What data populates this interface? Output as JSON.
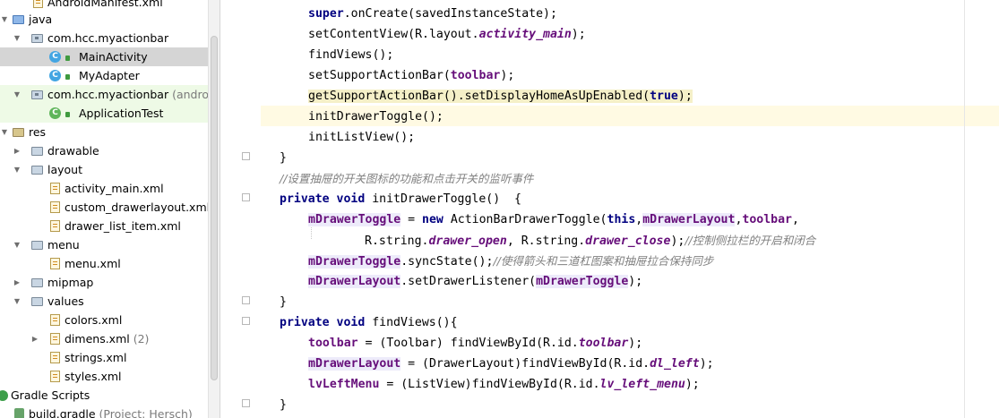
{
  "project_tree": {
    "items": [
      {
        "label": "AndroidManifest.xml",
        "suffix": "",
        "icon": "xml-file-icon"
      },
      {
        "label": "java",
        "suffix": "",
        "icon": "source-folder-icon"
      },
      {
        "label": "com.hcc.myactionbar",
        "suffix": "",
        "icon": "package-icon"
      },
      {
        "label": "MainActivity",
        "suffix": "",
        "icon": "class-icon"
      },
      {
        "label": "MyAdapter",
        "suffix": "",
        "icon": "class-icon"
      },
      {
        "label": "com.hcc.myactionbar",
        "suffix": " (androidTest)",
        "icon": "package-icon"
      },
      {
        "label": "ApplicationTest",
        "suffix": "",
        "icon": "test-class-icon"
      },
      {
        "label": "res",
        "suffix": "",
        "icon": "resource-folder-icon"
      },
      {
        "label": "drawable",
        "suffix": "",
        "icon": "folder-icon"
      },
      {
        "label": "layout",
        "suffix": "",
        "icon": "folder-icon"
      },
      {
        "label": "activity_main.xml",
        "suffix": "",
        "icon": "xml-file-icon"
      },
      {
        "label": "custom_drawerlayout.xml",
        "suffix": "",
        "icon": "xml-file-icon"
      },
      {
        "label": "drawer_list_item.xml",
        "suffix": "",
        "icon": "xml-file-icon"
      },
      {
        "label": "menu",
        "suffix": "",
        "icon": "folder-icon"
      },
      {
        "label": "menu.xml",
        "suffix": "",
        "icon": "xml-file-icon"
      },
      {
        "label": "mipmap",
        "suffix": "",
        "icon": "folder-icon"
      },
      {
        "label": "values",
        "suffix": "",
        "icon": "folder-icon"
      },
      {
        "label": "colors.xml",
        "suffix": "",
        "icon": "xml-file-icon"
      },
      {
        "label": "dimens.xml",
        "suffix": " (2)",
        "icon": "xml-file-icon"
      },
      {
        "label": "strings.xml",
        "suffix": "",
        "icon": "xml-file-icon"
      },
      {
        "label": "styles.xml",
        "suffix": "",
        "icon": "xml-file-icon"
      },
      {
        "label": "Gradle Scripts",
        "suffix": "",
        "icon": "gradle-icon"
      },
      {
        "label": "build.gradle",
        "suffix": " (Project: Hersch)",
        "icon": "gradle-file-icon"
      }
    ]
  },
  "code": {
    "line_super": [
      "super",
      ".onCreate(savedInstanceState);"
    ],
    "line_setContentView": [
      "setContentView(R.layout.",
      "activity_main",
      ");"
    ],
    "line_findViews_call": "findViews();",
    "line_setSupportActionBar": [
      "setSupportActionBar(",
      "toolbar",
      ");"
    ],
    "line_getSupport": [
      "getSupportActionBar().setDisplayHomeAsUpEnabled(",
      "true",
      ");"
    ],
    "line_initDrawerToggle_call": "initDrawerToggle();",
    "line_initListView_call": "initListView();",
    "brace_close": "}",
    "comment_drawer": "//设置抽屉的开关图标的功能和点击开关的监听事件",
    "decl_initDrawerToggle": [
      "private",
      "void",
      " initDrawerToggle()  {"
    ],
    "line_mDrawerToggle_new": [
      "mDrawerToggle",
      " = ",
      "new",
      " ActionBarDrawerToggle(",
      "this",
      ",",
      "mDrawerLayout",
      ",",
      "toolbar",
      ","
    ],
    "line_rstring": [
      "R.string.",
      "drawer_open",
      ", R.string.",
      "drawer_close",
      ");",
      "//控制侧拉栏的开启和闭合"
    ],
    "line_syncState": [
      "mDrawerToggle",
      ".syncState();",
      "//使得箭头和三道杠图案和抽屉拉合保持同步"
    ],
    "line_setDrawerListener": [
      "mDrawerLayout",
      ".setDrawerListener(",
      "mDrawerToggle",
      ");"
    ],
    "decl_findViews": [
      "private",
      "void",
      " findViews(){"
    ],
    "line_toolbar_find": [
      "toolbar",
      " = (Toolbar) findViewById(R.id.",
      "toolbar",
      ");"
    ],
    "line_drawerlayout_find": [
      "mDrawerLayout",
      " = (DrawerLayout)findViewById(R.id.",
      "dl_left",
      ");"
    ],
    "line_lvleft_find": [
      "lvLeftMenu",
      " = (ListView)findViewById(R.id.",
      "lv_left_menu",
      ");"
    ]
  }
}
